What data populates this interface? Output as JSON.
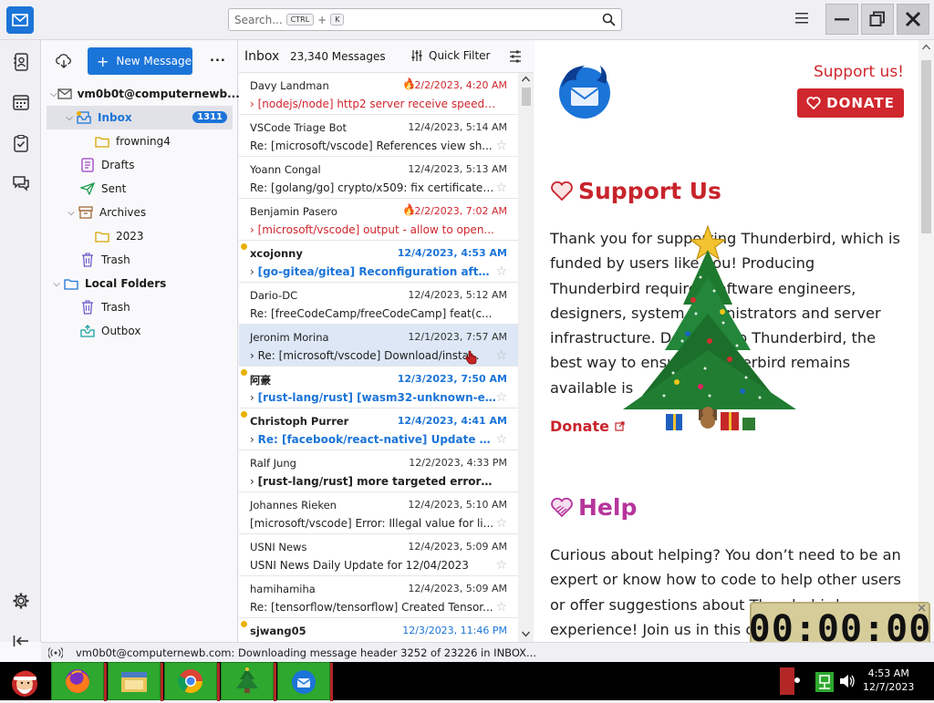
{
  "search": {
    "placeholder": "Search...",
    "key1": "CTRL",
    "plus": "+",
    "key2": "K"
  },
  "toolbar": {
    "new_message": "New Message",
    "more": "..."
  },
  "folders": {
    "account": "vm0b0t@computernewb....",
    "inbox": "Inbox",
    "inbox_count": "1311",
    "frowning": "frowning4",
    "drafts": "Drafts",
    "sent": "Sent",
    "archives": "Archives",
    "archive_2023": "2023",
    "trash": "Trash",
    "local_folders": "Local Folders",
    "local_trash": "Trash",
    "outbox": "Outbox"
  },
  "list_header": {
    "folder": "Inbox",
    "count": "23,340 Messages",
    "quick_filter": "Quick Filter"
  },
  "messages": [
    {
      "from": "Davy Landman",
      "date": "12/2/2023, 4:20 AM",
      "subject": "[nodejs/node] http2 server receive speed ..."
    },
    {
      "from": "VSCode Triage Bot",
      "date": "12/4/2023, 5:14 AM",
      "subject": "Re: [microsoft/vscode] References view sh..."
    },
    {
      "from": "Yoann Congal",
      "date": "12/4/2023, 5:13 AM",
      "subject": "Re: [golang/go] crypto/x509: fix certificate ..."
    },
    {
      "from": "Benjamin Pasero",
      "date": "12/2/2023, 7:02 AM",
      "subject": "[microsoft/vscode] output - allow to open..."
    },
    {
      "from": "xcojonny",
      "date": "12/4/2023, 4:53 AM",
      "subject": "[go-gitea/gitea] Reconfiguration afte..."
    },
    {
      "from": "Dario-DC",
      "date": "12/4/2023, 5:12 AM",
      "subject": "Re: [freeCodeCamp/freeCodeCamp] feat(c..."
    },
    {
      "from": "Jeronim Morina",
      "date": "12/1/2023, 7:57 AM",
      "subject": "Re: [microsoft/vscode] Download/insta..."
    },
    {
      "from": "阿豪",
      "date": "12/3/2023, 7:50 AM",
      "subject": "[rust-lang/rust] [wasm32-unknown-e..."
    },
    {
      "from": "Christoph Purrer",
      "date": "12/4/2023, 4:41 AM",
      "subject": "Re: [facebook/react-native] Update G..."
    },
    {
      "from": "Ralf Jung",
      "date": "12/2/2023, 4:33 PM",
      "subject": "[rust-lang/rust] more targeted errors ..."
    },
    {
      "from": "Johannes Rieken",
      "date": "12/4/2023, 5:10 AM",
      "subject": "[microsoft/vscode] Error: Illegal value for li..."
    },
    {
      "from": "USNI News",
      "date": "12/4/2023, 5:09 AM",
      "subject": "USNI News Daily Update for 12/04/2023"
    },
    {
      "from": "hamihamiha",
      "date": "12/4/2023, 5:09 AM",
      "subject": "Re: [tensorflow/tensorflow] Created Tensor..."
    },
    {
      "from": "sjwang05",
      "date": "12/3/2023, 11:46 PM",
      "subject": ""
    }
  ],
  "reader": {
    "support_link": "Support us!",
    "donate_btn": "DONATE",
    "support_heading": "Support Us",
    "support_text": "Thank you for supporting Thunderbird, which is funded by users like you! Producing Thunderbird requires software engineers, designers, system administrators and server infrastructure. Donating to Thunderbird, the best way to ensure Thunderbird remains available is",
    "donate_link": "Donate",
    "help_heading": "Help",
    "help_text": "Curious about helping? You don’t need to be an expert or know how to code to help other users or offer suggestions about Thunderbird... experience! Join us in this c"
  },
  "status": {
    "text": "vm0b0t@computernewb.com: Downloading message header 3252 of 23226 in INBOX..."
  },
  "timer": "00:00:00",
  "taskbar": {
    "time": "4:53 AM",
    "date": "12/7/2023"
  },
  "colors": {
    "accent": "#1b74d8",
    "red": "#d0262d",
    "taskbar_green": "#2ea82e"
  }
}
